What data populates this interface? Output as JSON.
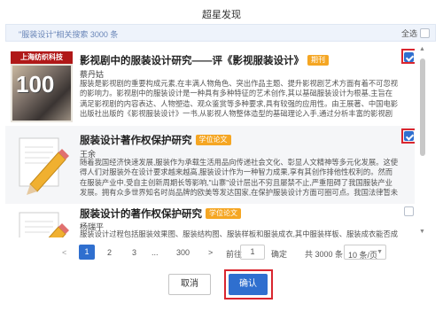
{
  "dialog": {
    "title": "超星发现"
  },
  "filter": {
    "query": "\"服装设计\"相关搜索 3000 条",
    "select_all_label": "全选"
  },
  "items": [
    {
      "title": "影视剧中的服装设计研究——评《影视服装设计》",
      "badge": "期刊",
      "author": "蔡丹姑",
      "abstract": "服装是影视剧的重要构成元素,在丰满人物角色、突出作品主题、提升影视剧艺术方面有着不可忽视的影响力。影视剧中的服装设计是一种具有多种特征的艺术创作,其以基础服装设计为根基,主旨在满足影视剧的内容表达、人物塑造、观众鉴赏等多种要求,具有较强的应用性。由王展著、中国电影出版社出版的《影视服装设计》一书,从影视人物整体造型的基础理论入手,通过分析丰富的影视剧服装造型...",
      "thumb_text": "上海纺织科技",
      "thumb_number": "100",
      "checked": true
    },
    {
      "title": "服装设计著作权保护研究",
      "badge": "学位论文",
      "author": "王余",
      "abstract": "随着我国经济快速发展,服装作为承载生活用品向传递社会文化、彰显人文精神等多元化发展。这使得人们对服装外在设计要求越来越高,服装设计作为一种智力成果,享有其创作排他性权利的。然而在服装产业中,受自主创新周期长等影响,\"山寨\"设计层出不穷且屡禁不止,严重阻碍了我国服装产业发展。拥有众多世界知名时尚品牌的欧美等发达国家,在保护服装设计方面可圈可点。我国法律暂未明...",
      "checked": true
    },
    {
      "title": "服装设计的著作权保护研究",
      "badge": "学位论文",
      "author": "杨瑞平",
      "abstract": "服装设计过程包括服装效果图、服装结构图、服装样板和服装成衣,其中服装样板、服装成衣能否成为著作权保护的客体存在争议,依据《著作权法》中对于作品的定义,服装样板与服装成衣制作过程中充满着制版师和设计师独创性的智力成果,并以有形形式表现,满足著作权保护的客体条件,著作权保护具有可...",
      "checked": false
    }
  ],
  "pagination": {
    "prev": "<",
    "pages": [
      "1",
      "2",
      "3",
      "...",
      "300"
    ],
    "next": ">",
    "goto_label": "前往",
    "goto_value": "1",
    "goto_button": "确定",
    "total": "共 3000 条",
    "page_size": "10 条/页"
  },
  "buttons": {
    "cancel": "取消",
    "confirm": "确认"
  },
  "colors": {
    "accent": "#2f6fcf",
    "badge": "#f5a623",
    "highlight": "#d9262f"
  }
}
